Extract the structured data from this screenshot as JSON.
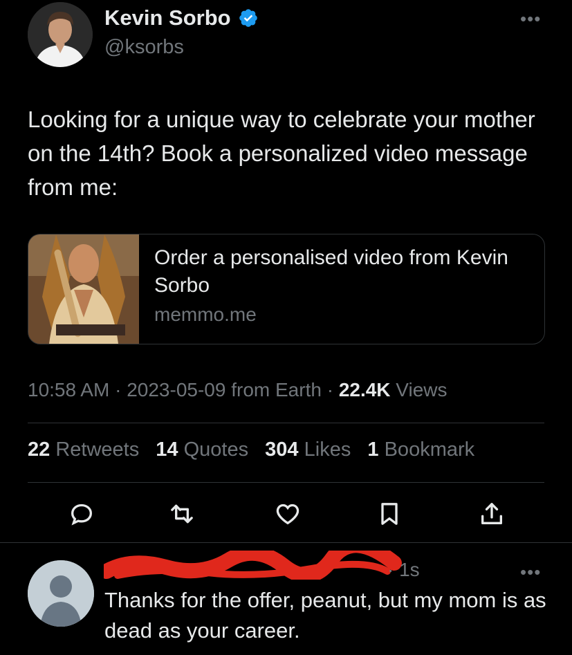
{
  "author": {
    "name": "Kevin Sorbo",
    "handle": "@ksorbs",
    "verified": true,
    "more": "•••"
  },
  "tweet": {
    "text": "Looking for a unique way to celebrate your mother on the 14th? Book a personalized video message from me:",
    "card": {
      "title": "Order a personalised video from Kevin Sorbo",
      "domain": "memmo.me"
    },
    "meta": {
      "time": "10:58 AM",
      "sep1": " · ",
      "date": "2023-05-09",
      "source": " from Earth",
      "sep2": " · ",
      "views_count": "22.4K",
      "views_label": " Views"
    },
    "stats": [
      {
        "count": "22",
        "label": "Retweets"
      },
      {
        "count": "14",
        "label": "Quotes"
      },
      {
        "count": "304",
        "label": "Likes"
      },
      {
        "count": "1",
        "label": "Bookmark"
      }
    ],
    "actions": [
      "reply-icon",
      "retweet-icon",
      "like-icon",
      "bookmark-icon",
      "share-icon"
    ]
  },
  "reply": {
    "time": "· 1s",
    "more": "•••",
    "text": "Thanks for the offer, peanut, but my mom is as dead as your career."
  },
  "colors": {
    "background": "#000000",
    "text": "#e7e9ea",
    "muted": "#71767b",
    "border": "#2f3336",
    "verified": "#1d9bf0",
    "redaction": "#e0281c"
  }
}
